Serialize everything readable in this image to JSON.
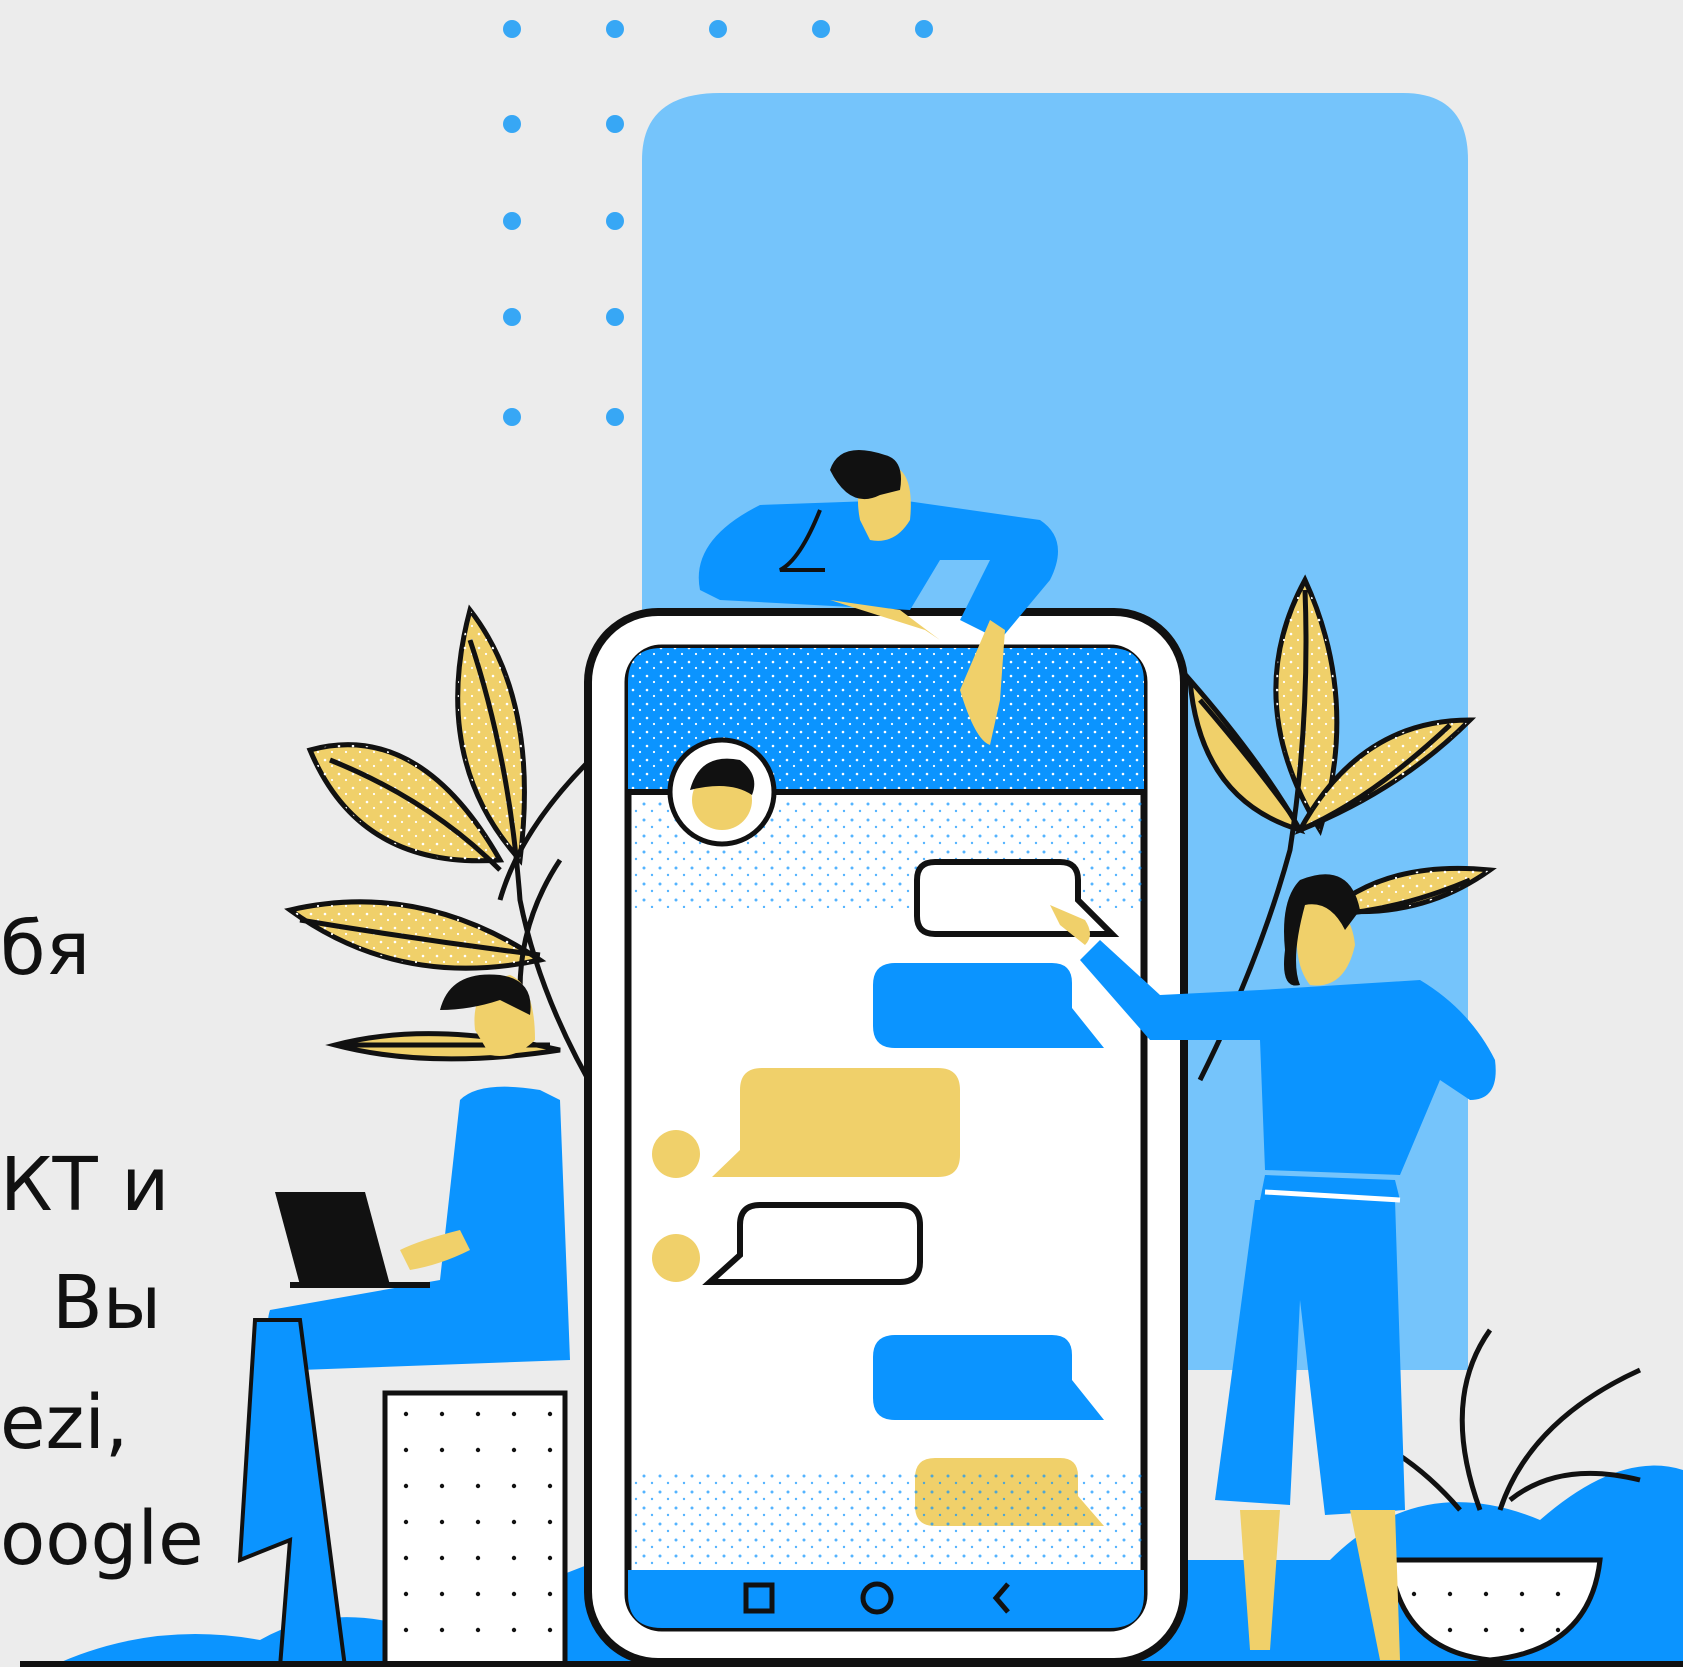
{
  "text_fragments": [
    "бя",
    "КТ и",
    "Вы",
    "ezi,",
    "oogle"
  ],
  "phone": {
    "nav_icons": [
      "square-icon",
      "circle-icon",
      "back-chevron-icon"
    ]
  },
  "colors": {
    "background": "#ececec",
    "light_blue_panel": "#75c4fb",
    "blue": "#0b94ff",
    "yellow": "#f0d06a",
    "outline": "#111111"
  }
}
